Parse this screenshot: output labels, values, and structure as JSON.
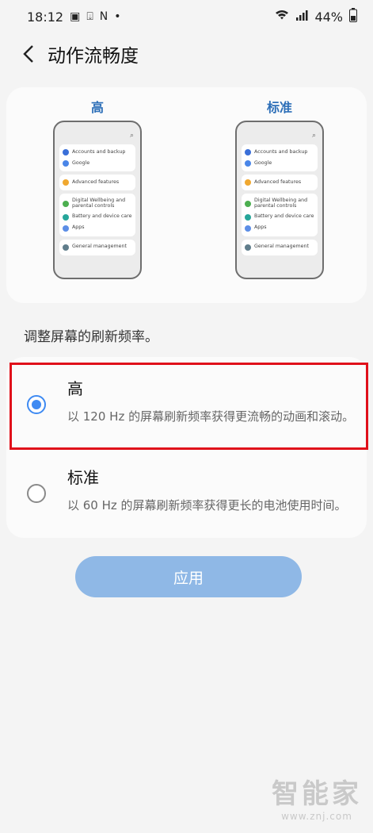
{
  "status": {
    "time": "18:12",
    "battery": "44%"
  },
  "header": {
    "title": "动作流畅度"
  },
  "previews": [
    {
      "label": "高"
    },
    {
      "label": "标准"
    }
  ],
  "mini_menu": {
    "accounts": "Accounts and backup",
    "google": "Google",
    "advanced": "Advanced features",
    "wellbeing": "Digital Wellbeing and parental controls",
    "battery": "Battery and device care",
    "apps": "Apps",
    "general": "General management"
  },
  "intro": "调整屏幕的刷新频率。",
  "options": [
    {
      "title": "高",
      "desc": "以 120 Hz 的屏幕刷新频率获得更流畅的动画和滚动。",
      "selected": true
    },
    {
      "title": "标准",
      "desc": "以 60 Hz 的屏幕刷新频率获得更长的电池使用时间。",
      "selected": false
    }
  ],
  "apply_label": "应用",
  "watermark": {
    "big": "智能家",
    "small": "www.znj.com"
  },
  "colors": {
    "accent": "#3e8af2",
    "apply_button": "#8fb8e6",
    "highlight": "#e0101a",
    "preview_label": "#2d6fb8"
  }
}
